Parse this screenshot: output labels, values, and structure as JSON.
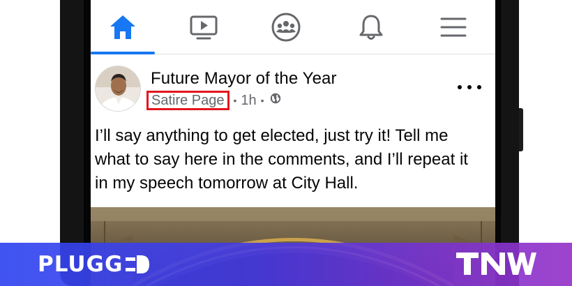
{
  "tab_bar": {
    "tabs": [
      {
        "name": "home",
        "icon": "home-icon",
        "active": true
      },
      {
        "name": "watch",
        "icon": "video-icon",
        "active": false
      },
      {
        "name": "groups",
        "icon": "groups-icon",
        "active": false
      },
      {
        "name": "notifications",
        "icon": "bell-icon",
        "active": false
      },
      {
        "name": "menu",
        "icon": "hamburger-menu-icon",
        "active": false
      }
    ],
    "accent_color": "#1877f2",
    "inactive_color": "#65676b"
  },
  "post": {
    "page_name": "Future Mayor of the Year",
    "category_label": "Satire Page",
    "separator": "•",
    "time": "1h",
    "audience_icon": "globe-icon",
    "more_icon": "more-options-icon",
    "text_lines": [
      "I’ll say anything to get elected, just try it! Tell me",
      "what to say here in the comments, and I’ll repeat it",
      "in my speech tomorrow at City Hall."
    ],
    "highlight_color": "#e4141c"
  },
  "banner": {
    "left_logo": "PLUGG",
    "right_logo": "TNW"
  }
}
